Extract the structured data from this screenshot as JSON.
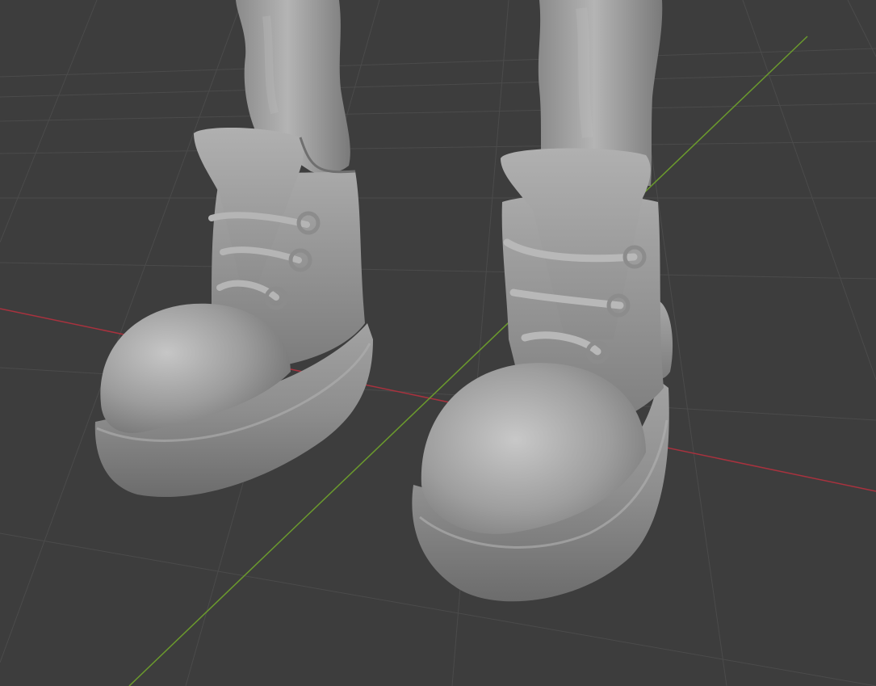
{
  "viewport": {
    "background": "#3d3d3d",
    "grid_color": "#4a4a4a",
    "x_axis_color": "#a8323e",
    "y_axis_color": "#6b9a2d"
  },
  "model": {
    "clay_base": "#9a9a9a",
    "clay_light": "#c4c4c4",
    "clay_dark": "#6a6a6a",
    "parts": [
      "left-leg",
      "right-leg",
      "left-boot",
      "right-boot"
    ]
  }
}
